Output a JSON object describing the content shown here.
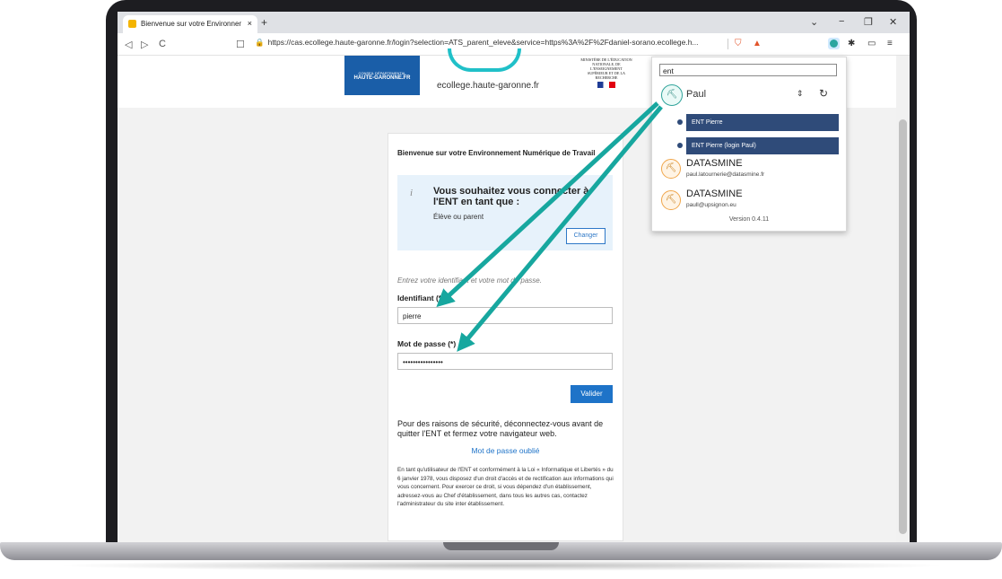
{
  "browser": {
    "tab_title": "Bienvenue sur votre Environneme",
    "tab_close": "×",
    "new_tab": "+",
    "url": "https://cas.ecollege.haute-garonne.fr/login?selection=ATS_parent_eleve&service=https%3A%2F%2Fdaniel-sorano.ecollege.h...",
    "nav": {
      "back": "◁",
      "forward": "▷",
      "reload": "C",
      "bookmark": "☐"
    },
    "window": {
      "collapse": "⌄",
      "minimize": "−",
      "restore": "❐",
      "close": "✕"
    }
  },
  "header": {
    "logo_hg_line1": "CONSEIL DÉPARTEMENTAL",
    "logo_hg_line2": "HAUTE-GARONNE.FR",
    "ecollege_site": "ecollege.haute-garonne.fr",
    "ministry": "MINISTÈRE DE L'ÉDUCATION NATIONALE, DE L'ENSEIGNEMENT SUPÉRIEUR ET DE LA RECHERCHE"
  },
  "login": {
    "title": "Bienvenue sur votre Environnement Numérique de Travail",
    "info_icon": "i",
    "info_title": "Vous souhaitez vous connecter à l'ENT en tant que :",
    "info_role": "Élève ou parent",
    "change_label": "Changer",
    "hint": "Entrez votre identifiant et votre mot de passe.",
    "username_label": "Identifiant (*)",
    "username_value": "pierre",
    "password_label": "Mot de passe (*)",
    "password_value": "••••••••••••••••",
    "submit_label": "Valider",
    "security_warning": "Pour des raisons de sécurité, déconnectez-vous avant de quitter l'ENT et fermez votre navigateur web.",
    "forgot_link": "Mot de passe oublié",
    "legal_text": "En tant qu'utilisateur de l'ENT et conformément à la Loi « Informatique et Libertés » du 6 janvier 1978, vous disposez d'un droit d'accès et de rectification aux informations qui vous concernent. Pour exercer ce droit, si vous dépendez d'un établissement, adressez-vous au Chef d'établissement, dans tous les autres cas, contactez l'administrateur du site inter établissement."
  },
  "popup": {
    "search_value": "ent",
    "profile_name": "Paul",
    "sort_icon": "⇕",
    "refresh_icon": "↻",
    "items": [
      {
        "label": "ENT Pierre"
      },
      {
        "label": "ENT Pierre (login Paul)"
      }
    ],
    "accounts": [
      {
        "name": "DATASMINE",
        "email": "paul.latournerie@datasmine.fr"
      },
      {
        "name": "DATASMINE",
        "email": "paull@upsignon.eu"
      }
    ],
    "version": "Version 0.4.11"
  },
  "colors": {
    "arrow": "#17a79f",
    "primary_button": "#1e73c8",
    "popup_item": "#2f4b79"
  }
}
